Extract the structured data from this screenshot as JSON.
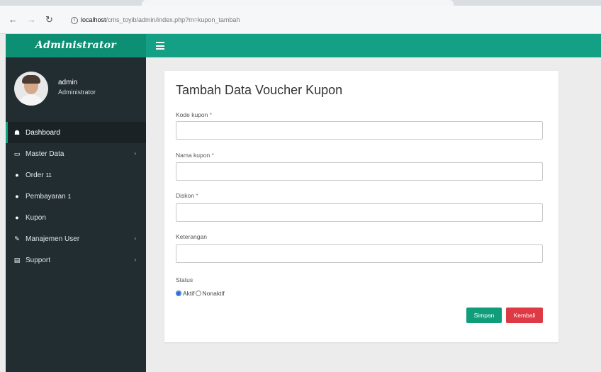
{
  "browser": {
    "back": "←",
    "forward": "→",
    "reload": "↻",
    "url_host": "localhost",
    "url_path": "/cms_toyib/admin/index.php?m=kupon_tambah"
  },
  "header": {
    "brand": "Administrator",
    "toggle_icon": "hamburger-icon",
    "colors": {
      "brand_bg": "#0d8f73",
      "topbar_bg": "#14a085"
    }
  },
  "sidebar": {
    "user": {
      "name": "admin",
      "role": "Administrator"
    },
    "items": [
      {
        "label": "Dashboard",
        "icon": "dashboard-icon",
        "glyph": "☗",
        "active": true,
        "has_children": false,
        "count": ""
      },
      {
        "label": "Master Data",
        "icon": "monitor-icon",
        "glyph": "▭",
        "active": false,
        "has_children": true,
        "count": ""
      },
      {
        "label": "Order",
        "icon": "circle-icon",
        "glyph": "●",
        "active": false,
        "has_children": false,
        "count": "11"
      },
      {
        "label": "Pembayaran",
        "icon": "circle-icon",
        "glyph": "●",
        "active": false,
        "has_children": false,
        "count": "1"
      },
      {
        "label": "Kupon",
        "icon": "circle-icon",
        "glyph": "●",
        "active": false,
        "has_children": false,
        "count": ""
      },
      {
        "label": "Manajemen User",
        "icon": "edit-icon",
        "glyph": "✎",
        "active": false,
        "has_children": true,
        "count": ""
      },
      {
        "label": "Support",
        "icon": "list-icon",
        "glyph": "▤",
        "active": false,
        "has_children": true,
        "count": ""
      }
    ],
    "chevron": "›"
  },
  "form": {
    "title": "Tambah Data Voucher Kupon",
    "fields": [
      {
        "label": "Kode kupon",
        "required": "*",
        "value": ""
      },
      {
        "label": "Nama kupon",
        "required": "*",
        "value": ""
      },
      {
        "label": "Diskon",
        "required": "*",
        "value": ""
      },
      {
        "label": "Keterangan",
        "required": "",
        "value": ""
      }
    ],
    "status": {
      "label": "Status",
      "options": [
        {
          "label": "Aktif",
          "checked": true
        },
        {
          "label": "Nonaktif",
          "checked": false
        }
      ]
    },
    "save_label": "Simpan",
    "cancel_label": "Kembali"
  }
}
